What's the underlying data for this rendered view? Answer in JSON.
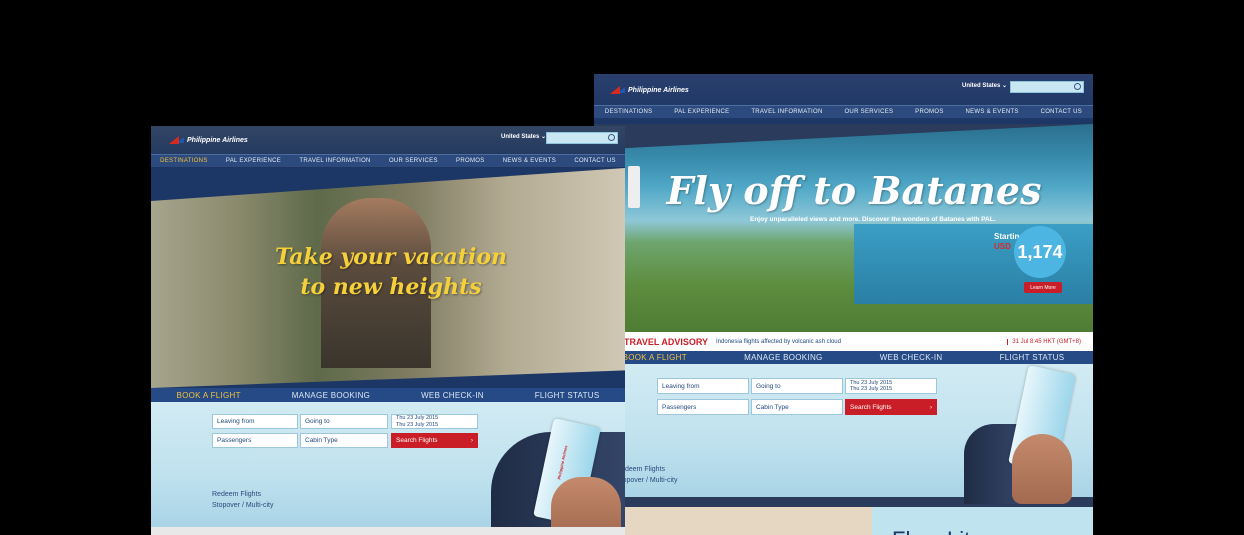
{
  "brand": "Philippine Airlines",
  "region": "United States",
  "nav": [
    "DESTINATIONS",
    "PAL EXPERIENCE",
    "TRAVEL INFORMATION",
    "OUR SERVICES",
    "PROMOS",
    "NEWS & EVENTS",
    "CONTACT US"
  ],
  "tabs": [
    "BOOK A FLIGHT",
    "MANAGE BOOKING",
    "WEB CHECK-IN",
    "FLIGHT STATUS"
  ],
  "form": {
    "leaving_from": "Leaving from",
    "going_to": "Going to",
    "date_depart": "Thu 23 July 2015",
    "date_return": "Thu 23 July 2015",
    "passengers": "Passengers",
    "cabin_type": "Cabin Type",
    "search_button": "Search Flights",
    "redeem": "Redeem Flights",
    "stopover": "Stopover / Multi-city"
  },
  "left_hero": {
    "headline_1": "Take your vacation",
    "headline_2": "to new heights"
  },
  "right_hero": {
    "headline": "Fly off to Batanes",
    "sub": "Enjoy unparalleled views and more. Discover the wonders of Batanes with PAL.",
    "starting_from": "Starting from",
    "currency": "USD",
    "price": "1,174",
    "learn_more": "Learn More"
  },
  "advisory": {
    "title": "TRAVEL ADVISORY",
    "message": "Indonesia flights affected by volcanic ash cloud",
    "time": "31 Jul 8:45 HKT (GMT+8)"
  },
  "right_bottom_partial": "Flyer Lite",
  "colors": {
    "navy": "#1c3666",
    "nav_blue": "#2c4a7d",
    "accent_yellow": "#f2c23b",
    "brand_red": "#c91e27",
    "sky": "#bfe1ee"
  }
}
